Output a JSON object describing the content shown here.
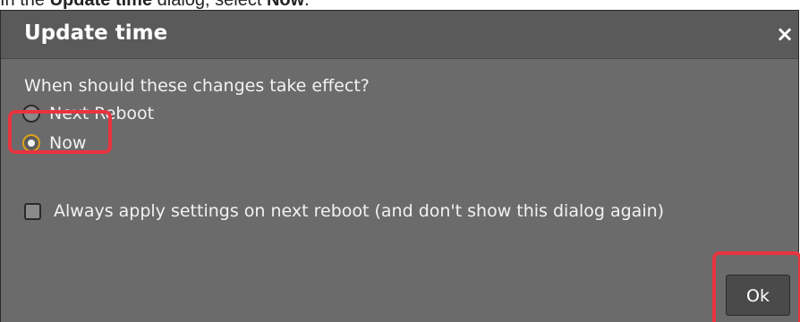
{
  "instruction": {
    "prefix": "In the ",
    "dialog_name": "Update time",
    "middle": " dialog, select ",
    "target": "Now",
    "suffix": "."
  },
  "dialog": {
    "title": "Update time",
    "close_icon": "close-icon",
    "close_glyph": "×",
    "question": "When should these changes take effect?",
    "options": [
      {
        "label": "Next Reboot",
        "selected": false
      },
      {
        "label": "Now",
        "selected": true
      }
    ],
    "checkbox": {
      "label": "Always apply settings on next reboot (and don't show this dialog again)",
      "checked": false
    },
    "ok_label": "Ok"
  },
  "colors": {
    "dialog_bg": "#6b6b6b",
    "titlebar_bg": "#5a5a5a",
    "highlight": "#e8343f",
    "radio_selected": "#e0a21a",
    "button_bg": "#4a4a4a"
  }
}
